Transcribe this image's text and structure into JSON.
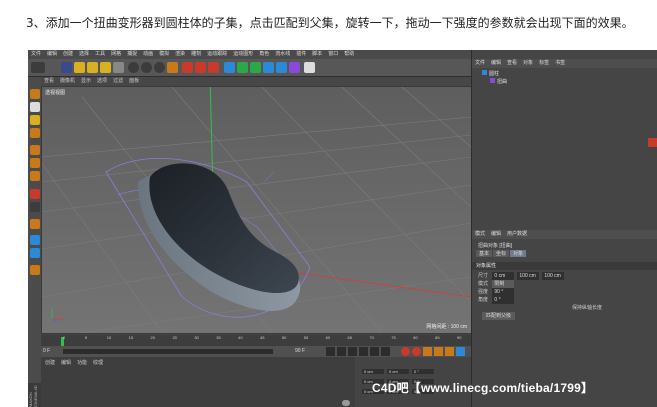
{
  "caption": "3、添加一个扭曲变形器到圆柱体的子集，点击匹配到父集，旋转一下，拖动一下强度的参数就会出现下面的效果。",
  "app": {
    "menu": [
      "文件",
      "编辑",
      "创建",
      "选择",
      "工具",
      "网格",
      "捕捉",
      "动画",
      "模拟",
      "渲染",
      "雕刻",
      "运动跟踪",
      "运动图形",
      "角色",
      "流水线",
      "插件",
      "脚本",
      "窗口",
      "帮助"
    ],
    "viewport_menu": [
      "查看",
      "摄像机",
      "显示",
      "选项",
      "过滤",
      "面板"
    ],
    "viewport_name": "透视视图",
    "grid_label": "网格间距 : 100 cm",
    "timeline": {
      "ticks": [
        "0",
        "5",
        "10",
        "15",
        "20",
        "25",
        "30",
        "35",
        "40",
        "45",
        "50",
        "55",
        "60",
        "65",
        "70",
        "75",
        "80",
        "85",
        "90"
      ],
      "start": "0 F",
      "end": "90 F",
      "current": "0 F"
    },
    "material_menu": [
      "创建",
      "编辑",
      "功能",
      "纹理"
    ],
    "maxon": "MAXON CINEMA 4D"
  },
  "object_manager": {
    "menu": [
      "文件",
      "编辑",
      "查看",
      "对象",
      "标签",
      "书签"
    ],
    "objects": [
      {
        "name": "圆柱",
        "indent": 0
      },
      {
        "name": "扭曲",
        "indent": 1
      }
    ]
  },
  "attribute_manager": {
    "menu": [
      "模式",
      "编辑",
      "用户数据"
    ],
    "title": "扭曲对象 [扭曲]",
    "tabs": [
      "基本",
      "坐标",
      "对象"
    ],
    "active_tab": "对象",
    "section": "对象属性",
    "rows": [
      {
        "label": "尺寸",
        "values": [
          "0 cm",
          "100 cm",
          "100 cm"
        ]
      },
      {
        "label": "模式",
        "values": [
          "限制"
        ]
      },
      {
        "label": "强度",
        "values": [
          "90 °"
        ]
      },
      {
        "label": "角度",
        "values": [
          "0 °"
        ]
      },
      {
        "label": "保持纵轴长度",
        "values": [
          ""
        ]
      }
    ],
    "fit_button": "匹配到父级"
  },
  "coords": {
    "rows": [
      {
        "a": "0 cm",
        "b": "0 cm",
        "c": "0 °"
      },
      {
        "a": "0 cm",
        "b": "0 cm",
        "c": "0 °"
      },
      {
        "a": "0 cm",
        "b": "0 cm",
        "c": "0 °"
      }
    ]
  },
  "watermark": "C4D吧【www.linecg.com/tieba/1799】",
  "colors": {
    "viewport_bg": "#6b6b6b",
    "accent_select": "#8a7fd8",
    "axis_y": "#33c04a",
    "axis_x": "#d93a3a"
  }
}
